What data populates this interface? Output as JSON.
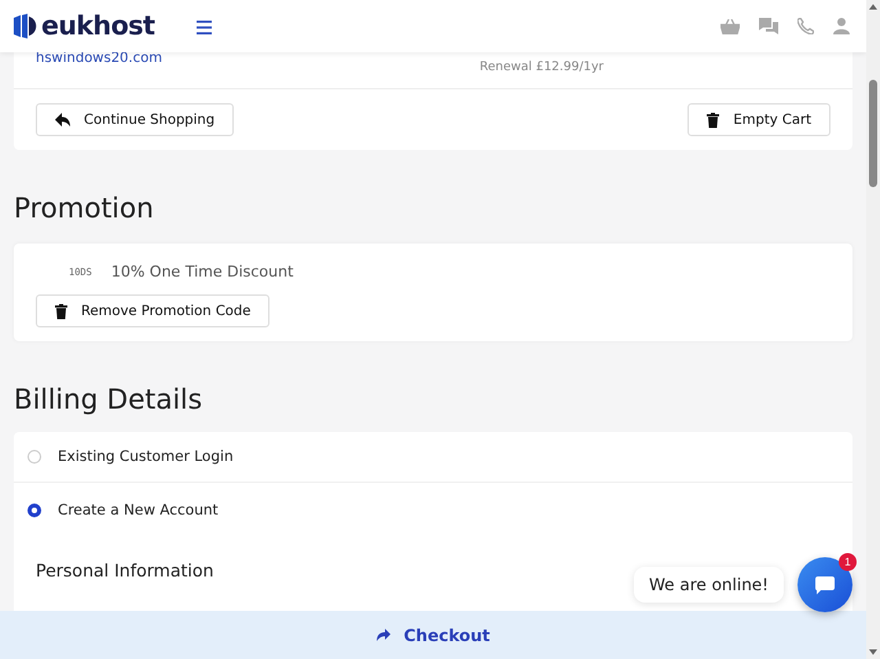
{
  "header": {
    "logo": "eukhost"
  },
  "cart": {
    "domain": "hswindows20.com",
    "renewal": "Renewal £12.99/1yr",
    "buttons": [
      {
        "kind": "back",
        "label": "Continue Shopping"
      },
      {
        "kind": "trash",
        "label": "Empty Cart"
      }
    ]
  },
  "promotion": {
    "heading": "Promotion",
    "code": "10DS",
    "description": "10% One Time Discount",
    "button": "Remove Promotion Code"
  },
  "billing": {
    "heading": "Billing Details",
    "options": [
      {
        "label": "Existing Customer Login",
        "selected": false
      },
      {
        "label": "Create a New Account",
        "selected": true
      }
    ],
    "section": "Personal Information"
  },
  "chat": {
    "message": "We are online!",
    "badge": "1"
  },
  "checkout": {
    "label": "Checkout"
  }
}
